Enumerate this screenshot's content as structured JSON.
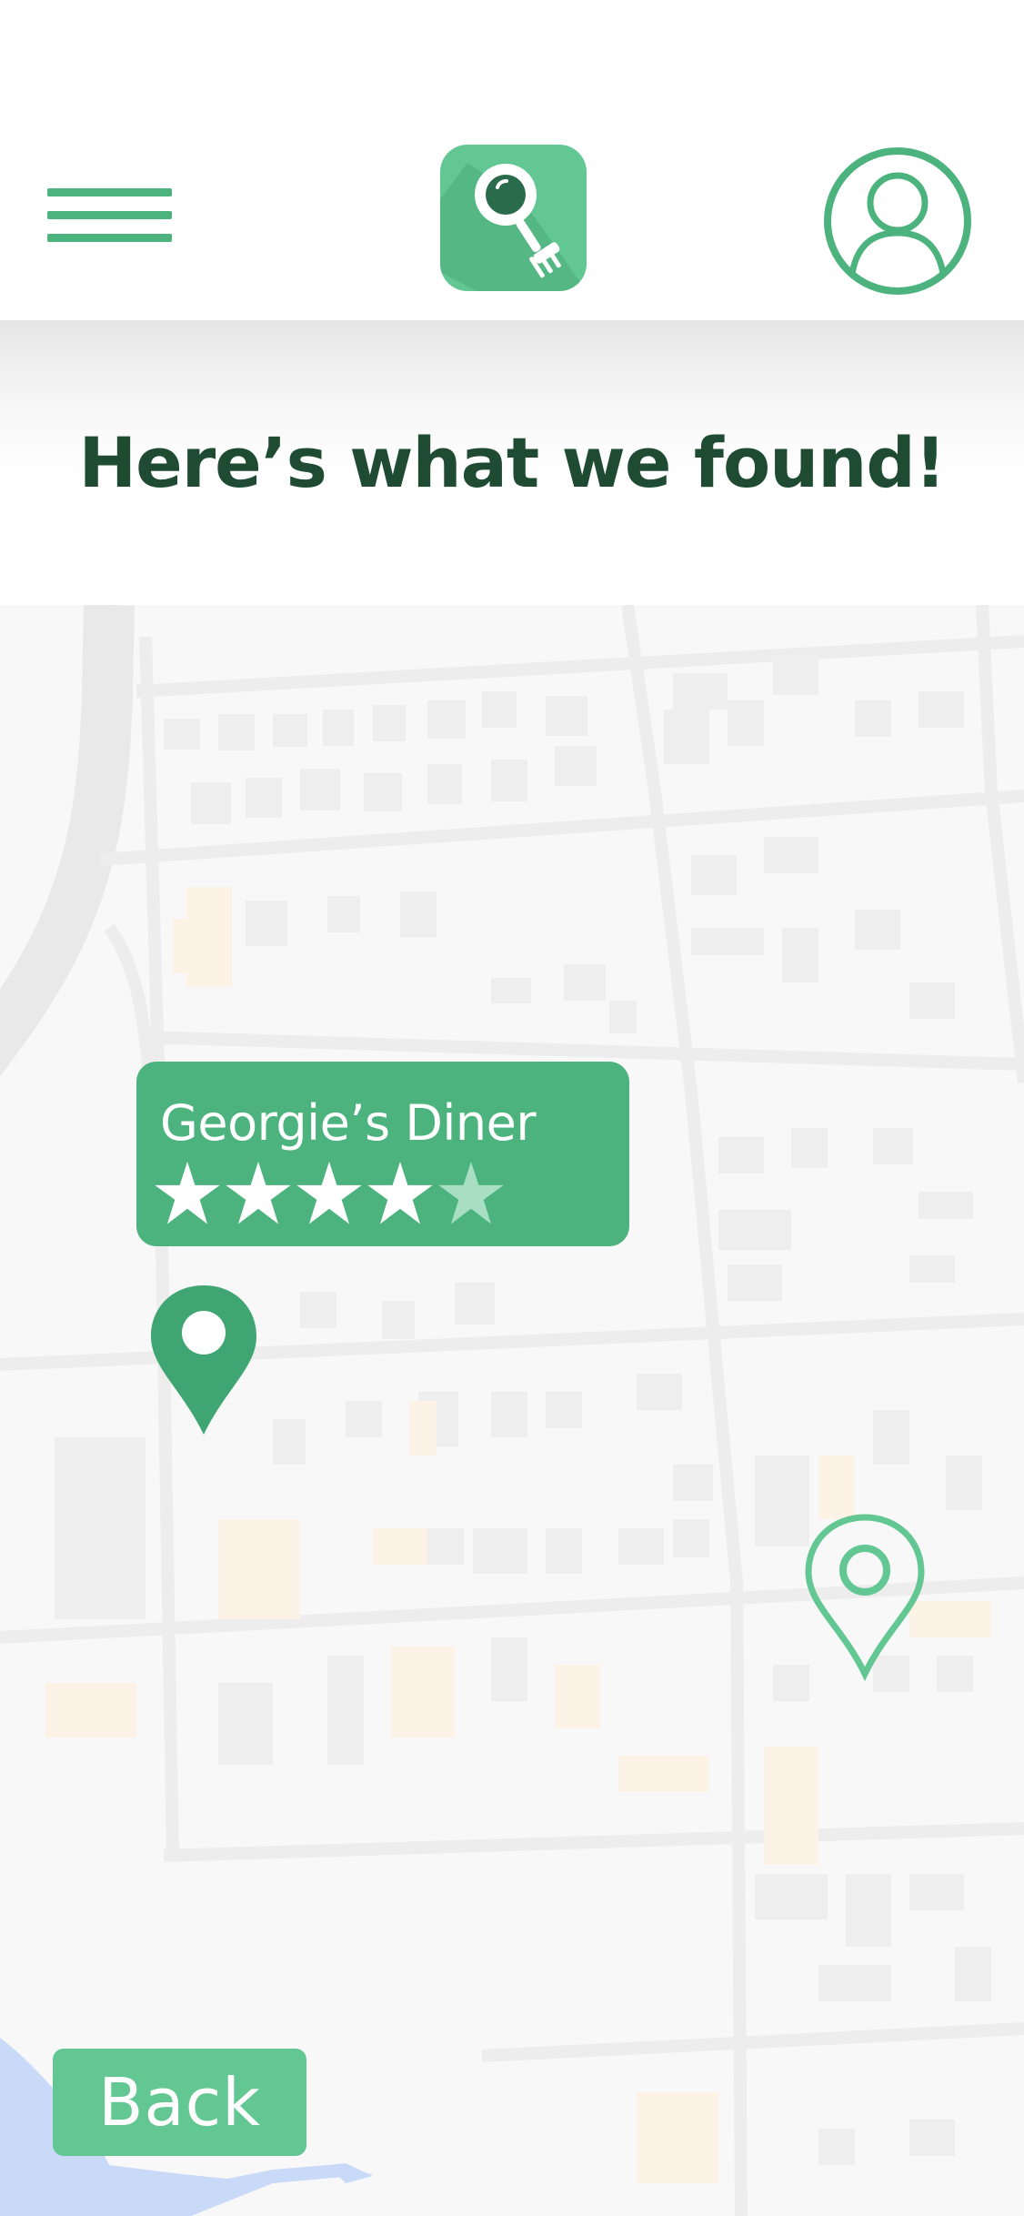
{
  "header": {
    "menu_icon": "hamburger-menu-icon",
    "logo_icon": "magnifier-fork-logo-icon",
    "profile_icon": "user-profile-icon",
    "accent_color": "#4db37e",
    "logo_color": "#62c793"
  },
  "banner": {
    "title": "Here’s what we found!",
    "title_color": "#1e4b32"
  },
  "map": {
    "selected_place": {
      "name": "Georgie’s Diner",
      "rating": 4,
      "rating_max": 5,
      "star_icon": "star-icon"
    },
    "pins": [
      {
        "icon": "map-pin-filled-icon",
        "state": "selected"
      },
      {
        "icon": "map-pin-outline-icon",
        "state": "unselected"
      }
    ]
  },
  "footer": {
    "back_label": "Back"
  }
}
